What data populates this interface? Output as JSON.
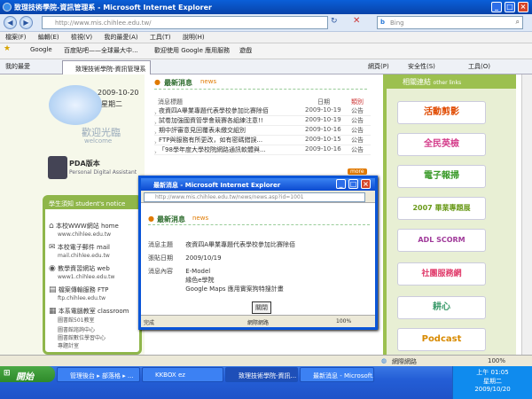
{
  "window": {
    "title": "致理技術學院-資訊管理系 - Microsoft Internet Explorer"
  },
  "address": {
    "url": "http://www.mis.chihlee.edu.tw/",
    "search_placeholder": "Bing"
  },
  "menu": [
    "檔案(F)",
    "編輯(E)",
    "檢視(V)",
    "我的最愛(A)",
    "工具(T)",
    "說明(H)"
  ],
  "favorites": {
    "items": [
      "Google",
      "百度貼吧——全球最大中...",
      "歡迎使用 Google 應用服務",
      "遊戲"
    ],
    "fav_label": "我的最愛",
    "tab_label": "致理技術學院-資訊管理系",
    "right_items": [
      "網頁(P)",
      "安全性(S)",
      "工具(O)"
    ]
  },
  "left": {
    "date": "2009-10-20",
    "weekday": "星期二",
    "welcome": "歡迎光臨",
    "welcome_en": "welcome",
    "pda_label": "PDA版本",
    "pda_en": "Personal Digital Assistant",
    "notice_title": "學生須知",
    "notice_en": "student's notice",
    "notices": [
      {
        "title": "本校WWW網站 home",
        "sub": "www.chihlee.edu.tw"
      },
      {
        "title": "本校電子郵件 mail",
        "sub": "mail.chihlee.edu.tw"
      },
      {
        "title": "教學資習網站 web",
        "sub": "www1.chihlee.edu.tw"
      },
      {
        "title": "檔案傳輸服務 FTP",
        "sub": "ftp.chihlee.edu.tw"
      },
      {
        "title": "本系電腦教室 classroom",
        "sub": "圖書館501教室"
      }
    ],
    "extra": [
      "圖書館諮詢中心",
      "圖書館數位學習中心",
      "專題計室"
    ]
  },
  "news": {
    "title": "最新消息",
    "title_en": "news",
    "col_title": "消息標題",
    "col_date": "日期",
    "col_cat": "類別",
    "rows": [
      {
        "title": "夜資四A畢業專題代表學校參加比賽除佰",
        "date": "2009-10-19",
        "cat": "公告"
      },
      {
        "title": "試卷加強國資管學會競賽各組練注意!!",
        "date": "2009-10-19",
        "cat": "公告"
      },
      {
        "title": "期中評審意見回覆表未繳交組別",
        "date": "2009-10-16",
        "cat": "公告"
      },
      {
        "title": "FTP與服務有所更改，如有密碼錯誤...",
        "date": "2009-10-15",
        "cat": "公告"
      },
      {
        "title": "「98學年度大學校院網路通訊軟體與...",
        "date": "2009-10-16",
        "cat": "公告"
      }
    ],
    "more": "more"
  },
  "right": {
    "title": "相關連結",
    "title_en": "other links",
    "links": [
      "活動剪影",
      "全民英檢",
      "電子報掃",
      "2007 畢業專題展",
      "ADL SCORM",
      "社團服務網",
      "耕心",
      "Podcast"
    ]
  },
  "popup": {
    "title": "最新消息 - Microsoft Internet Explorer",
    "url": "http://www.mis.chihlee.edu.tw/news/news.asp?id=1001",
    "heading": "最新消息",
    "heading_en": "news",
    "subject_label": "消息主題",
    "subject": "夜資四A畢業專題代表學校參加比賽除佰",
    "date_label": "張貼日期",
    "date": "2009/10/19",
    "content_label": "消息內容",
    "content": [
      "E-Model",
      "緣色e學院",
      "Google Maps 應用實案狗特搜計畫"
    ],
    "close_label": "關閉",
    "status_left": "完成",
    "status_zone": "網際網路",
    "zoom": "100%"
  },
  "statusbar": {
    "zone": "網際網路",
    "zoom": "100%"
  },
  "taskbar": {
    "start": "開始",
    "tasks": [
      "管理後台 ▸ 部落格 ▸ ...",
      "KKBOX ez",
      "致理技術學院-資訊...",
      "最新消息 - Microsoft..."
    ],
    "time": "上午 01:05",
    "weekday": "星期二",
    "date": "2009/10/20"
  }
}
